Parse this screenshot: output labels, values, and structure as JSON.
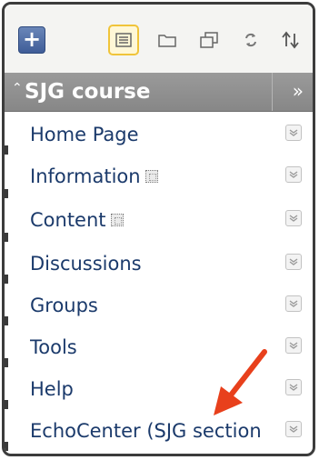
{
  "toolbar": {
    "add_symbol": "+",
    "tools": [
      {
        "icon": "list-view-icon",
        "active": true
      },
      {
        "icon": "folder-icon",
        "active": false
      },
      {
        "icon": "window-icon",
        "active": false
      },
      {
        "icon": "refresh-icon",
        "active": false
      },
      {
        "icon": "sort-icon",
        "active": false
      }
    ]
  },
  "course": {
    "title": "SJG course",
    "collapse_glyph": "⌃",
    "expand_glyph": "»"
  },
  "menu": {
    "items": [
      {
        "label": "Home Page",
        "hidden": false
      },
      {
        "label": "Information",
        "hidden": true
      },
      {
        "label": "Content",
        "hidden": true
      },
      {
        "label": "Discussions",
        "hidden": false
      },
      {
        "label": "Groups",
        "hidden": false
      },
      {
        "label": "Tools",
        "hidden": false
      },
      {
        "label": "Help",
        "hidden": false
      },
      {
        "label": "EchoCenter (SJG section",
        "hidden": false
      }
    ]
  },
  "annotation": {
    "arrow_color": "#e8401c"
  },
  "colors": {
    "link": "#1b3a6b",
    "course_bar": "#8f8f8f",
    "accent_add": "#4a68a4",
    "active_tool_border": "#f0c43a"
  }
}
